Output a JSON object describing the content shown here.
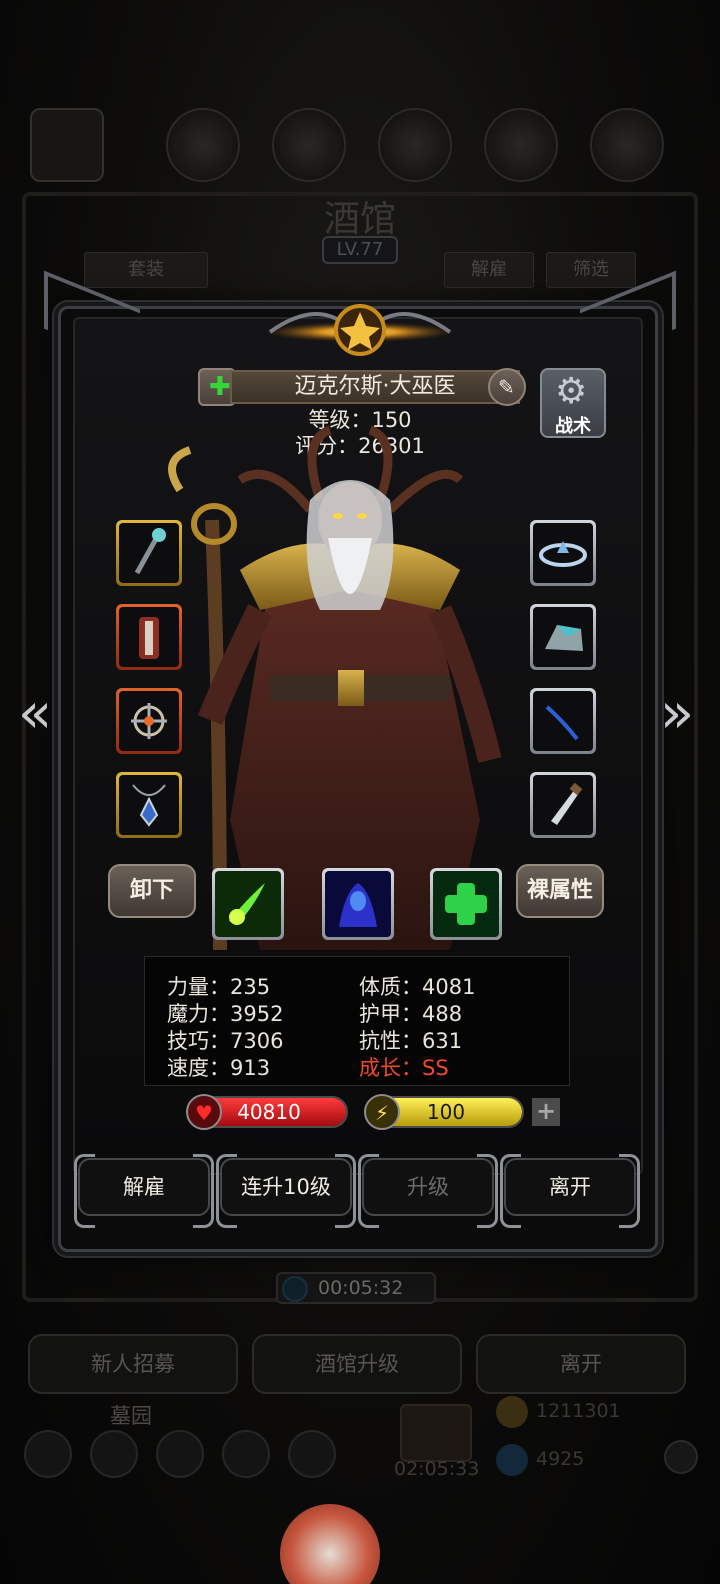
{
  "background": {
    "title": "酒馆",
    "level": "LV.77",
    "pills": {
      "set": "套装",
      "dismiss": "解雇",
      "filter": "筛选"
    },
    "timer": "00:05:32",
    "buttons": {
      "recruit": "新人招募",
      "upgrade_tavern": "酒馆升级",
      "leave": "离开"
    },
    "graveyard": "墓园",
    "gift_timer": "02:05:33",
    "gold": "1211301",
    "gems": "4925"
  },
  "hero": {
    "name": "迈克尔斯·大巫医",
    "level_label": "等级：",
    "level": "150",
    "score_label": "评分：",
    "score": "26301",
    "tactics": "战术"
  },
  "equipment": {
    "left": [
      {
        "name": "staff",
        "frame": "gold"
      },
      {
        "name": "armor",
        "frame": "red"
      },
      {
        "name": "ring",
        "frame": "red"
      },
      {
        "name": "amulet",
        "frame": "gold"
      }
    ],
    "right": [
      {
        "name": "crown",
        "frame": "silver"
      },
      {
        "name": "gem-stone",
        "frame": "silver"
      },
      {
        "name": "bow",
        "frame": "silver"
      },
      {
        "name": "dagger",
        "frame": "silver"
      }
    ]
  },
  "skill_row": {
    "unequip": "卸下",
    "bare_stats": "裸属性",
    "skills": [
      "green-claw-skill",
      "blue-spirit-skill",
      "heal-cross-skill"
    ]
  },
  "attributes": {
    "strength": {
      "label": "力量：",
      "value": "235"
    },
    "constitution": {
      "label": "体质：",
      "value": "4081"
    },
    "magic": {
      "label": "魔力：",
      "value": "3952"
    },
    "armor": {
      "label": "护甲：",
      "value": "488"
    },
    "skill": {
      "label": "技巧：",
      "value": "7306"
    },
    "resistance": {
      "label": "抗性：",
      "value": "631"
    },
    "speed": {
      "label": "速度：",
      "value": "913"
    },
    "growth": {
      "label": "成长：",
      "value": "SS"
    }
  },
  "bars": {
    "hp": "40810",
    "energy": "100",
    "hp_fill": 1.0,
    "energy_fill": 1.0
  },
  "actions": {
    "dismiss": "解雇",
    "level_up_10": "连升10级",
    "level_up": "升级",
    "leave": "离开"
  },
  "colors": {
    "growth": "#f0492a",
    "hp": "#d8141c",
    "energy": "#e6cf14",
    "heal_skill": "#2fd04a"
  }
}
